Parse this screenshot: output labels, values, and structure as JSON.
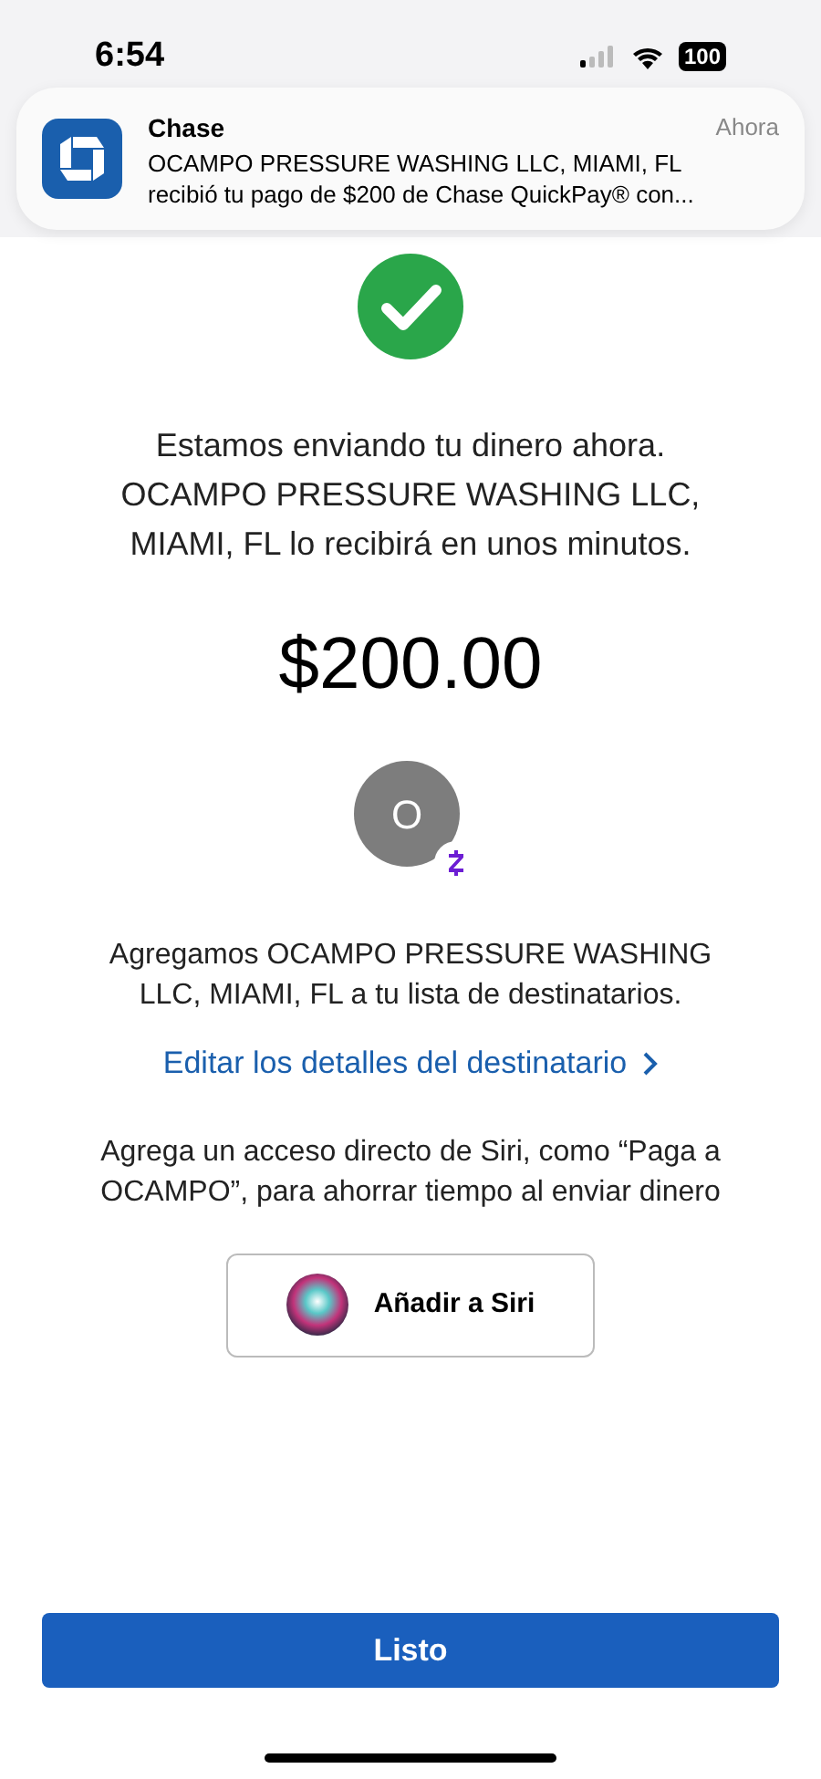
{
  "status_bar": {
    "time": "6:54",
    "battery": "100"
  },
  "notification": {
    "app": "Chase",
    "time": "Ahora",
    "line_1": "OCAMPO PRESSURE WASHING LLC, MIAMI, FL",
    "line_2": "recibió tu pago de $200 de Chase QuickPay® con..."
  },
  "message": [
    "Estamos enviando tu dinero ahora.",
    "OCAMPO PRESSURE WASHING LLC,",
    "MIAMI, FL lo recibirá en unos minutos."
  ],
  "amount": "$200.00",
  "recipient": {
    "initial": "O",
    "added_text": "Agregamos OCAMPO PRESSURE WASHING LLC, MIAMI, FL a tu lista de destinatarios.",
    "edit_link": "Editar los detalles del destinatario"
  },
  "siri": {
    "text": "Agrega un acceso directo de Siri, como “Paga a OCAMPO”, para ahorrar tiempo al enviar dinero",
    "button": "Añadir a Siri"
  },
  "done_button": "Listo"
}
